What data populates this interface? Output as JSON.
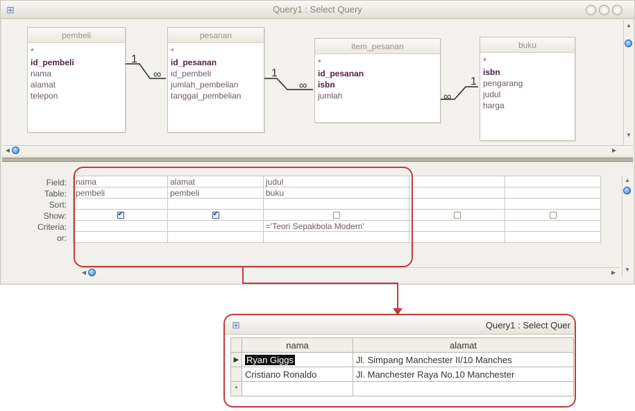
{
  "window": {
    "title": "Query1 : Select Query"
  },
  "tables": [
    {
      "name": "pembeli",
      "fields": [
        {
          "label": "*",
          "key": false
        },
        {
          "label": "id_pembeli",
          "key": true
        },
        {
          "label": "nama",
          "key": false
        },
        {
          "label": "alamat",
          "key": false
        },
        {
          "label": "telepon",
          "key": false
        }
      ]
    },
    {
      "name": "pesanan",
      "fields": [
        {
          "label": "*",
          "key": false
        },
        {
          "label": "id_pesanan",
          "key": true
        },
        {
          "label": "id_pembeli",
          "key": false
        },
        {
          "label": "jumlah_pembelian",
          "key": false
        },
        {
          "label": "tanggal_pembelian",
          "key": false
        }
      ]
    },
    {
      "name": "item_pesanan",
      "fields": [
        {
          "label": "*",
          "key": false
        },
        {
          "label": "id_pesanan",
          "key": true
        },
        {
          "label": "isbn",
          "key": true
        },
        {
          "label": "jumlah",
          "key": false
        }
      ]
    },
    {
      "name": "buku",
      "fields": [
        {
          "label": "*",
          "key": false
        },
        {
          "label": "isbn",
          "key": true
        },
        {
          "label": "pengarang",
          "key": false
        },
        {
          "label": "judul",
          "key": false
        },
        {
          "label": "harga",
          "key": false
        }
      ]
    }
  ],
  "relationships": {
    "one_symbol": "1",
    "many_symbol": "∞"
  },
  "grid": {
    "row_labels": [
      "Field:",
      "Table:",
      "Sort:",
      "Show:",
      "Criteria:",
      "or:"
    ],
    "columns": [
      {
        "field": "nama",
        "table": "pembeli",
        "sort": "",
        "show": true,
        "criteria": "",
        "or": ""
      },
      {
        "field": "alamat",
        "table": "pembeli",
        "sort": "",
        "show": true,
        "criteria": "",
        "or": ""
      },
      {
        "field": "judul",
        "table": "buku",
        "sort": "",
        "show": false,
        "criteria": "='Teori Sepakbola Modern'",
        "or": ""
      },
      {
        "field": "",
        "table": "",
        "sort": "",
        "show": false,
        "criteria": "",
        "or": ""
      },
      {
        "field": "",
        "table": "",
        "sort": "",
        "show": false,
        "criteria": "",
        "or": ""
      }
    ]
  },
  "result": {
    "title": "Query1 : Select Quer",
    "headers": [
      "nama",
      "alamat"
    ],
    "rows": [
      {
        "nama": "Ryan Giggs",
        "alamat": "Jl. Simpang Manchester II/10 Manches",
        "current": true
      },
      {
        "nama": "Cristiano Ronaldo",
        "alamat": "Jl. Manchester Raya No.10 Manchester",
        "current": false
      }
    ],
    "new_row_marker": "*",
    "current_row_marker": "▶"
  },
  "colors": {
    "highlight_border": "#c23a3a",
    "key_field": "#4a2345",
    "scroll_knob": "#2f7ad0"
  }
}
